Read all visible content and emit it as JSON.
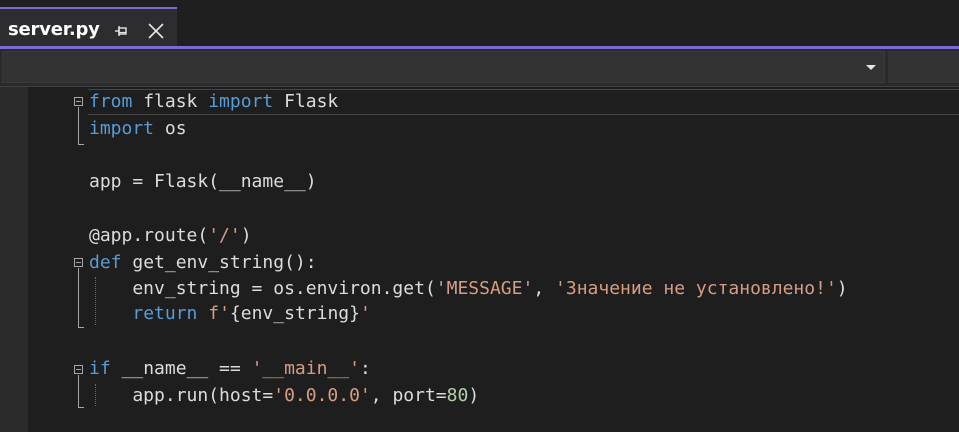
{
  "tab": {
    "title": "server.py",
    "pin_icon": "pin-icon",
    "close_icon": "close-icon"
  },
  "navbar": {
    "dropdown_icon": "chevron-down-icon"
  },
  "colors": {
    "accent": "#8167d6",
    "keyword": "#569cd6",
    "string": "#d69d85",
    "number": "#b5cea8",
    "text": "#dcdcdc",
    "background": "#1e1e1e"
  },
  "code": {
    "l1": {
      "t1": "from",
      "t2": " flask ",
      "t3": "import",
      "t4": " Flask"
    },
    "l2": {
      "t1": "import",
      "t2": " os"
    },
    "l3": {
      "t1": "app = Flask(__name__)"
    },
    "l4": {
      "t1": "@app.route(",
      "t2": "'/'",
      "t3": ")"
    },
    "l5": {
      "t1": "def",
      "t2": " get_env_string():"
    },
    "l6": {
      "t1": "    env_string = os.environ.get(",
      "t2": "'MESSAGE'",
      "t3": ", ",
      "t4": "'Значение не установлено!'",
      "t5": ")"
    },
    "l7": {
      "t1": "    ",
      "t2": "return",
      "t3": " ",
      "t4": "f'",
      "t5": "{env_string}",
      "t6": "'"
    },
    "l8": {
      "t1": "if",
      "t2": " __name__ == ",
      "t3": "'__main__'",
      "t4": ":"
    },
    "l9": {
      "t1": "    app.run(host=",
      "t2": "'0.0.0.0'",
      "t3": ", port=",
      "t4": "80",
      "t5": ")"
    }
  }
}
